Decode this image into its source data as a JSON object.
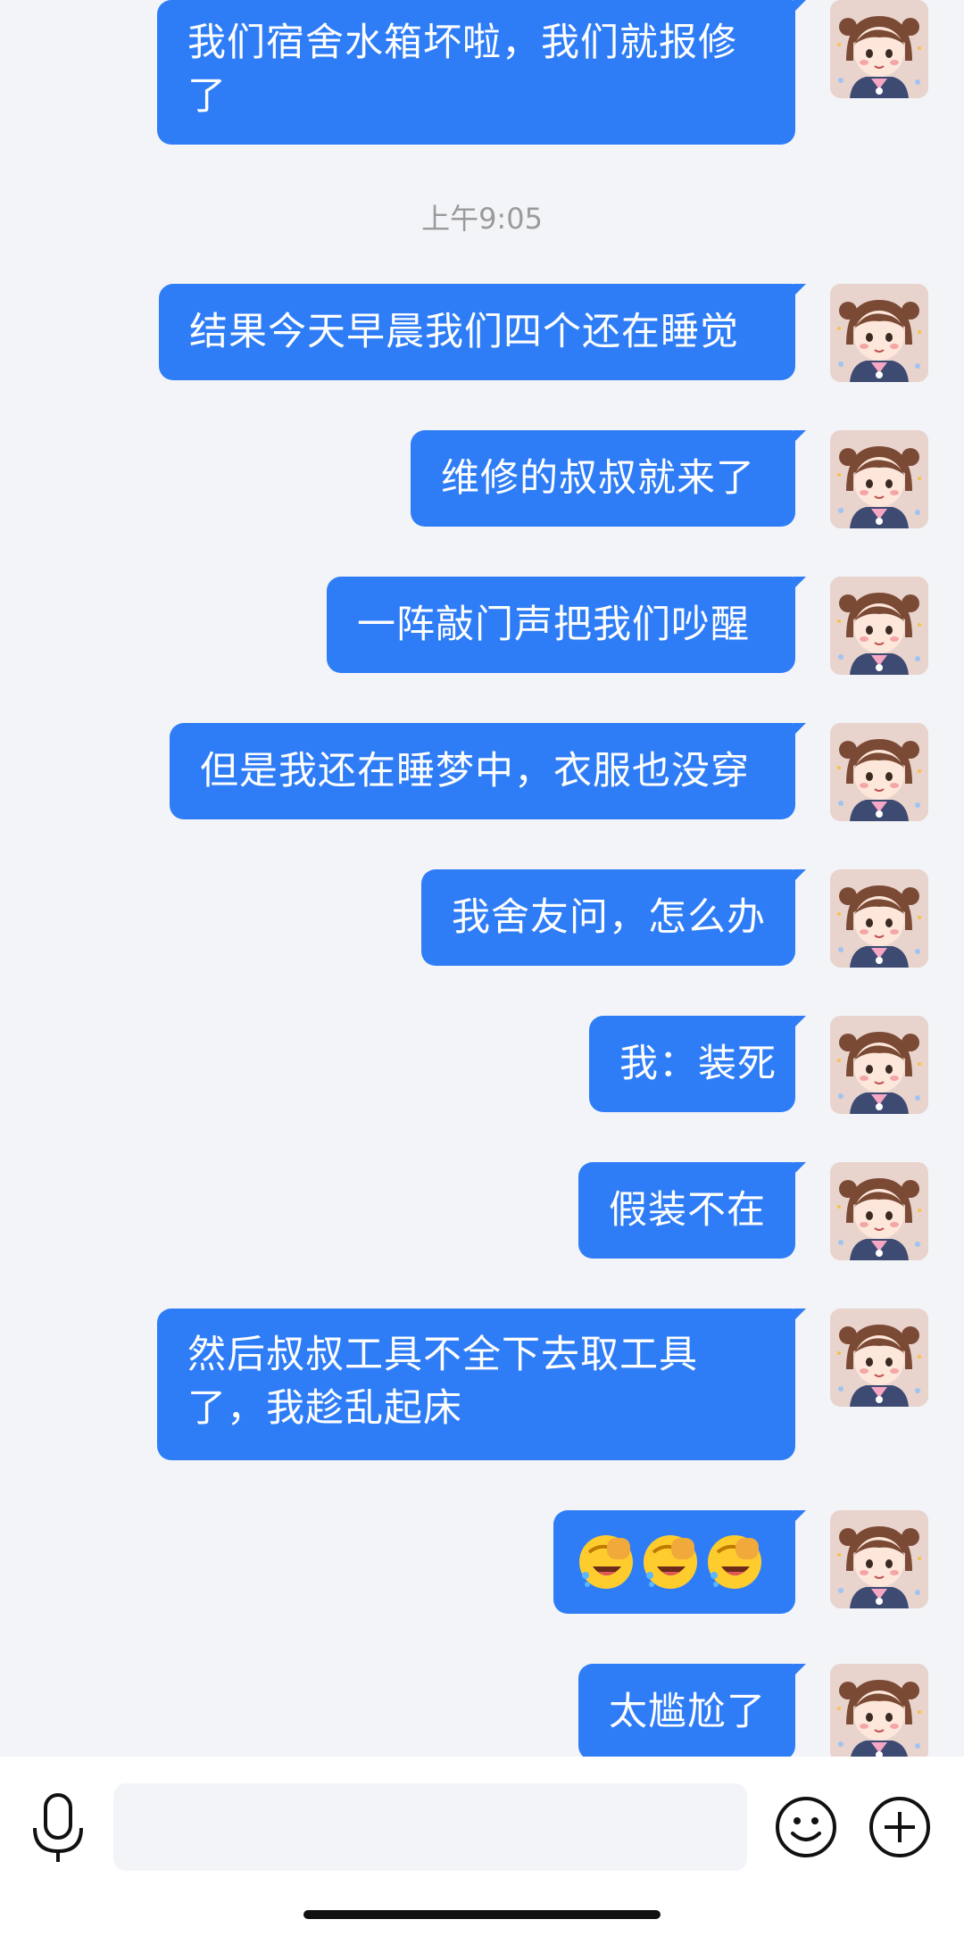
{
  "chat": {
    "timestamp": "上午9:05",
    "messages": [
      {
        "text": "我们宿舍水箱坏啦，我们就报修了"
      },
      {
        "text": "结果今天早晨我们四个还在睡觉"
      },
      {
        "text": "维修的叔叔就来了"
      },
      {
        "text": "一阵敲门声把我们吵醒"
      },
      {
        "text": "但是我还在睡梦中，衣服也没穿"
      },
      {
        "text": "我舍友问，怎么办"
      },
      {
        "text": "我：装死"
      },
      {
        "text": "假装不在"
      },
      {
        "text": "然后叔叔工具不全下去取工具了，我趁乱起床"
      },
      {
        "emoji": [
          "facepalm-laugh-emoji",
          "facepalm-laugh-emoji",
          "facepalm-laugh-emoji"
        ]
      },
      {
        "text": "太尴尬了"
      }
    ]
  },
  "input_bar": {
    "placeholder": "",
    "icons": [
      "microphone-icon",
      "smiley-icon",
      "plus-circle-icon"
    ]
  },
  "colors": {
    "bubble": "#2f7df6",
    "background": "#f3f4f8",
    "timestamp": "#9a9a9a"
  }
}
